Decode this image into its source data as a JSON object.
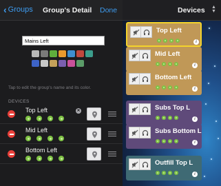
{
  "nav": {
    "back_label": "Groups",
    "title": "Group's Detail",
    "done_label": "Done"
  },
  "group": {
    "name_value": "Mains Left"
  },
  "palette": [
    [
      "#b8b8b8",
      "#7a7a7a",
      "#5fae3c",
      "#e99a2e",
      "#3f8fcf",
      "#c0483e",
      "#3c9d8c"
    ],
    [
      "#3d63c7",
      "#c8c8c8",
      "#c4a05a",
      "#7b5fb0",
      "#c9529a",
      "#5b9c68"
    ]
  ],
  "hint_text": "Tap to edit the group's name and its color.",
  "devices_header": "DEVICES",
  "devices": [
    {
      "name": "Top Left",
      "editing": true
    },
    {
      "name": "Mid Left",
      "editing": false
    },
    {
      "name": "Bottom Left",
      "editing": false
    }
  ],
  "right_panel": {
    "title": "Devices",
    "cards": [
      {
        "name": "Top Left",
        "color": "#c09857",
        "selected": true
      },
      {
        "name": "Mid Left",
        "color": "#c09857",
        "selected": false
      },
      {
        "name": "Bottom Left",
        "color": "#c09857",
        "selected": false
      },
      {
        "name": "Subs Top L",
        "color": "#5f4a7a",
        "selected": false
      },
      {
        "name": "Subs Bottom L",
        "color": "#5f4a7a",
        "selected": false
      },
      {
        "name": "Outfill Top L",
        "color": "#3f6a74",
        "selected": false
      }
    ]
  },
  "colors": {
    "accent": "#3e9cf0",
    "selection": "#f4d32b",
    "delete": "#e8403a",
    "status_dot": "#7ec244"
  }
}
